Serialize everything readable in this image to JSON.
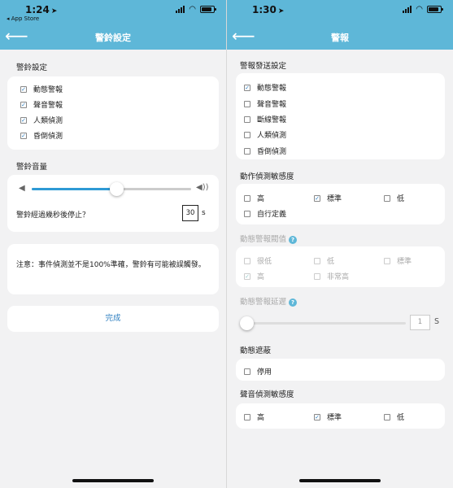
{
  "left": {
    "status": {
      "time": "1:24",
      "back_app": "◂ App Store"
    },
    "nav": {
      "title": "警鈴設定"
    },
    "alarm_settings": {
      "label": "警鈴設定",
      "items": [
        {
          "label": "動態警報",
          "checked": true
        },
        {
          "label": "聲音警報",
          "checked": true
        },
        {
          "label": "人類偵測",
          "checked": true
        },
        {
          "label": "昏倒偵測",
          "checked": true
        }
      ]
    },
    "volume": {
      "label": "警鈴音量",
      "level": 0.53,
      "stop_label": "警鈴經過幾秒後停止？",
      "stop_seconds": "30",
      "unit": "s"
    },
    "notice": "注意：事件偵測並不是100%準確，警鈴有可能被誤觸發。",
    "done_button": "完成"
  },
  "right": {
    "status": {
      "time": "1:30"
    },
    "nav": {
      "title": "警報"
    },
    "send_settings": {
      "label": "警報發送設定",
      "items": [
        {
          "label": "動態警報",
          "checked": true
        },
        {
          "label": "聲音警報",
          "checked": false
        },
        {
          "label": "斷線警報",
          "checked": false
        },
        {
          "label": "人類偵測",
          "checked": false
        },
        {
          "label": "昏倒偵測",
          "checked": false
        }
      ]
    },
    "motion_sensitivity": {
      "label": "動作偵測敏感度",
      "options": [
        {
          "label": "高",
          "checked": false
        },
        {
          "label": "標準",
          "checked": true
        },
        {
          "label": "低",
          "checked": false
        },
        {
          "label": "自行定義",
          "checked": false
        }
      ]
    },
    "motion_threshold": {
      "label": "動態警報閥值",
      "help": "?",
      "options": [
        {
          "label": "很低",
          "checked": false
        },
        {
          "label": "低",
          "checked": false
        },
        {
          "label": "標準",
          "checked": false
        },
        {
          "label": "高",
          "checked": true
        },
        {
          "label": "非常高",
          "checked": false
        }
      ]
    },
    "motion_delay": {
      "label": "動態警報延遲",
      "help": "?",
      "level": 0.0,
      "value": "1",
      "unit": "S"
    },
    "motion_mask": {
      "label": "動態遮蔽",
      "options": [
        {
          "label": "停用",
          "checked": false
        }
      ]
    },
    "sound_sensitivity": {
      "label": "聲音偵測敏感度",
      "options": [
        {
          "label": "高",
          "checked": false
        },
        {
          "label": "標準",
          "checked": true
        },
        {
          "label": "低",
          "checked": false
        }
      ]
    }
  },
  "icons": {
    "back": "arrow-left-icon",
    "location": "location-arrow-icon",
    "wifi": "wifi-icon",
    "battery": "battery-icon",
    "signal": "signal-icon",
    "volume_low": "volume-low-icon",
    "volume_high": "volume-high-icon",
    "help": "help-icon"
  },
  "colors": {
    "accent": "#5eb7d8",
    "link": "#2e7fc0",
    "slider": "#2e9ad5"
  }
}
